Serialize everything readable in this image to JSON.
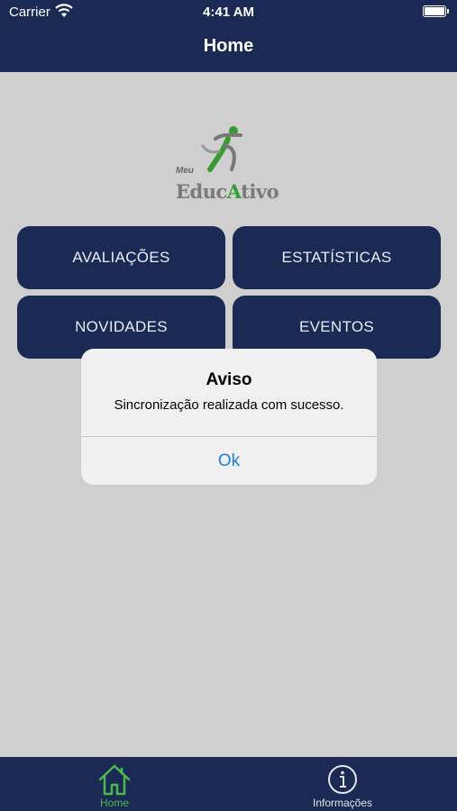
{
  "status_bar": {
    "carrier": "Carrier",
    "time": "4:41 AM"
  },
  "header": {
    "title": "Home"
  },
  "logo": {
    "line1": "Meu",
    "part1": "Educ",
    "accent": "A",
    "part2": "tivo"
  },
  "menu": {
    "avaliacoes": "AVALIAÇÕES",
    "estatisticas": "ESTATÍSTICAS",
    "novidades": "NOVIDADES",
    "eventos": "EVENTOS"
  },
  "alert": {
    "title": "Aviso",
    "message": "Sincronização realizada com sucesso.",
    "ok_label": "Ok"
  },
  "tabbar": {
    "home_label": "Home",
    "info_label": "Informações"
  },
  "colors": {
    "navy": "#1b2a55",
    "background": "#cfcfcf",
    "active_tab": "#4cb94a",
    "link_blue": "#1a7ee0"
  }
}
